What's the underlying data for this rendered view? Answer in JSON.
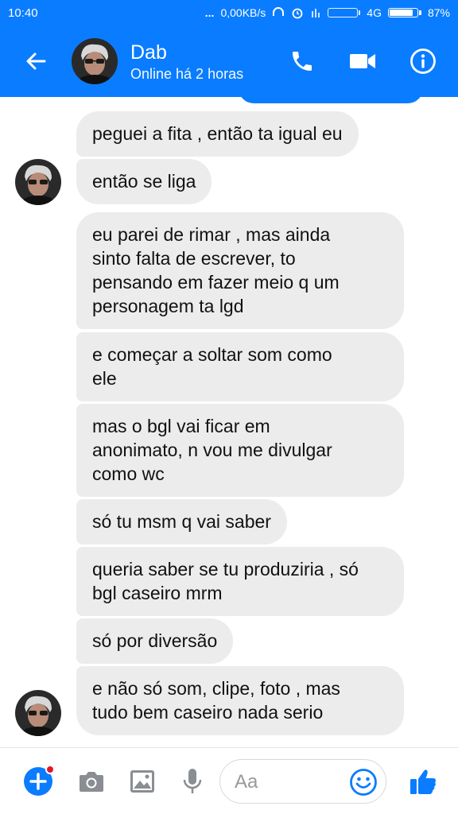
{
  "status_bar": {
    "time": "10:40",
    "dots": "...",
    "network_speed": "0,00KB/s",
    "network_type": "4G",
    "battery_percent": "87%",
    "battery_level": 0.87
  },
  "header": {
    "contact_name": "Dab",
    "presence": "Online há 2 horas",
    "icons": [
      "back-arrow-icon",
      "phone-icon",
      "video-camera-icon",
      "info-icon"
    ],
    "accent_color": "#0a7cff"
  },
  "messages": [
    "peguei a fita , então ta igual eu",
    "então se liga",
    "eu parei de rimar , mas ainda\nsinto falta de escrever, to\npensando em fazer meio q um\npersonagem ta lgd",
    "e começar a soltar som como\nele",
    "mas o bgl vai ficar em\nanonimato, n vou me divulgar\ncomo wc",
    "só tu msm q vai saber",
    "queria saber se tu produziria , só\nbgl caseiro mrm",
    "só por diversão",
    "e não só som, clipe, foto , mas\ntudo bem caseiro nada serio"
  ],
  "composer": {
    "placeholder": "Aa",
    "icons": [
      "plus-icon",
      "camera-icon",
      "image-icon",
      "microphone-icon",
      "emoji-icon",
      "thumbs-up-icon"
    ]
  }
}
